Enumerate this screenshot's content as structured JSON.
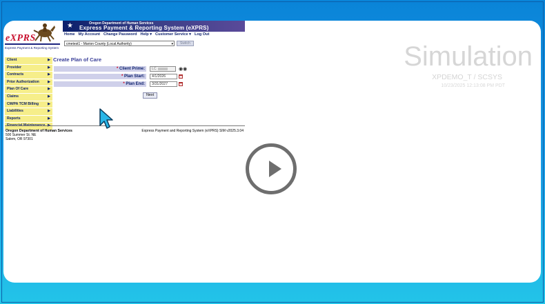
{
  "app": {
    "logo_text": "eXPRS",
    "logo_subtitle": "Express Payment & Reporting System",
    "banner_small": "Oregon Department of Human Services",
    "banner_title": "Express Payment & Reporting System (eXPRS)",
    "nav": {
      "home": "Home",
      "my_account": "My Account",
      "change_password": "Change Password",
      "help": "Help ▾",
      "customer_service": "Customer Service ▾",
      "log_out": "Log Out"
    },
    "context_select": "cmetest1 - Marion County (Local Authority)",
    "switch_label": "Switch",
    "menu": [
      {
        "label": "Client"
      },
      {
        "label": "Provider"
      },
      {
        "label": "Contracts"
      },
      {
        "label": "Prior Authorization"
      },
      {
        "label": "Plan Of Care"
      },
      {
        "label": "Claims"
      },
      {
        "label": "CM/PA TCM Billing"
      },
      {
        "label": "Liabilities"
      },
      {
        "label": "Reports"
      },
      {
        "label": "Financial Maintenance"
      }
    ],
    "page_title": "Create Plan of Care",
    "form": {
      "required_mark": "*",
      "client_prime_label": "Client Prime:",
      "client_prime_value": "LC",
      "plan_start_label": "Plan Start:",
      "plan_start_value": "4/1/2026",
      "plan_end_label": "Plan End:",
      "plan_end_value": "3/31/2027"
    },
    "next_label": "Next",
    "footer": {
      "org": "Oregon Department of Human Services",
      "address1": "500 Summer St. NE",
      "address2": "Salem, OR  97301",
      "version": "Express Payment and Reporting System (eXPRS) SIM v2025.3.04"
    }
  },
  "overlay": {
    "title": "Simulation",
    "user": "XPDEMO_T / SCSYS",
    "datetime": "10/23/2025 12:13:08 PM PDT"
  },
  "icons": {
    "play": "play-icon",
    "cursor": "mouse-pointer-icon",
    "lookup": "binoculars-icon",
    "calendar": "calendar-icon",
    "caret": "caret-right-icon"
  },
  "colors": {
    "menu_bg": "#f6ee8a",
    "banner": "#0b1f6b",
    "form_row": "#cfd0ea",
    "cursor": "#29b6e8",
    "background_top": "#0a84d8",
    "background_bottom": "#23c4e8"
  }
}
